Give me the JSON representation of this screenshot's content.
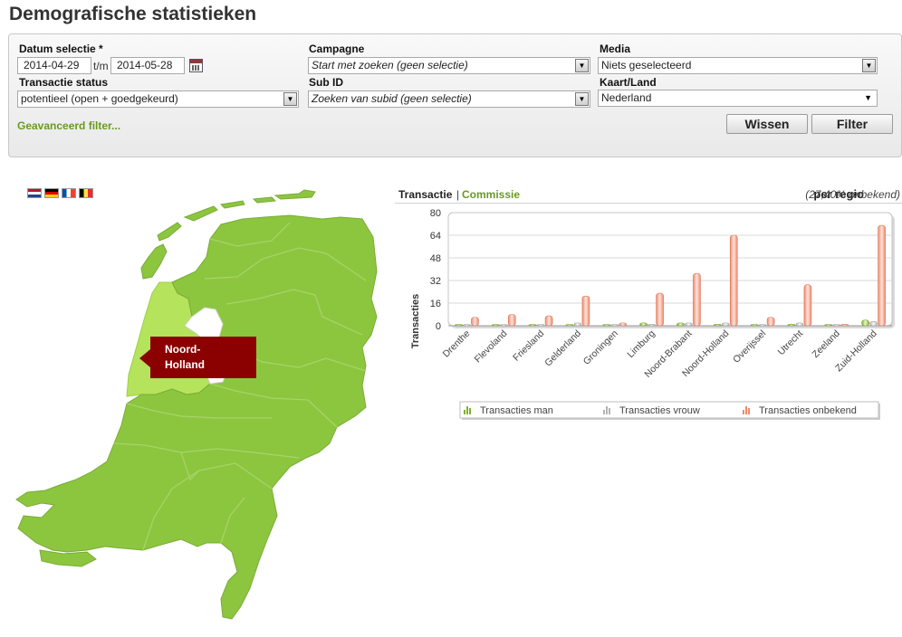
{
  "page": {
    "title": "Demografische statistieken"
  },
  "filters": {
    "datum_label": "Datum selectie *",
    "date_from": "2014-04-29",
    "tm_label": "t/m",
    "date_to": "2014-05-28",
    "campagne_label": "Campagne",
    "campagne_value": "Start met zoeken (geen selectie)",
    "media_label": "Media",
    "media_value": "Niets geselecteerd",
    "status_label": "Transactie status",
    "status_value": "potentieel (open + goedgekeurd)",
    "subid_label": "Sub ID",
    "subid_value": "Zoeken van subid (geen selectie)",
    "kaart_label": "Kaart/Land",
    "kaart_value": "Nederland",
    "advanced_link": "Geavanceerd filter...",
    "clear_button": "Wissen",
    "filter_button": "Filter"
  },
  "map": {
    "highlighted_region": "Noord-Holland",
    "tooltip_line1": "Noord-",
    "tooltip_line2": "Holland",
    "colors": {
      "region": "#8cc63f",
      "highlight": "#b5e35c",
      "tooltip": "#8b0000"
    }
  },
  "chart_header": {
    "tab_transactie": "Transactie",
    "separator": "|",
    "tab_commissie": "Commissie",
    "per_regio": "per regio",
    "onbekend": "(27,40% onbekend)"
  },
  "chart_data": {
    "type": "bar",
    "categories": [
      "Drenthe",
      "Flevoland",
      "Friesland",
      "Gelderland",
      "Groningen",
      "Limburg",
      "Noord-Brabant",
      "Noord-Holland",
      "Overijssel",
      "Utrecht",
      "Zeeland",
      "Zuid-Holland"
    ],
    "series": [
      {
        "name": "Transacties man",
        "color": "#8cc63f",
        "values": [
          0,
          0,
          0,
          0,
          0,
          2,
          2,
          1,
          0,
          1,
          0,
          4
        ]
      },
      {
        "name": "Transacties vrouw",
        "color": "#cccccc",
        "values": [
          0,
          0,
          0,
          2,
          0,
          1,
          2,
          2,
          0,
          2,
          0,
          3
        ]
      },
      {
        "name": "Transacties onbekend",
        "color": "#f4937a",
        "values": [
          6,
          8,
          7,
          21,
          2,
          23,
          37,
          64,
          6,
          29,
          1,
          71
        ]
      }
    ],
    "yticks": [
      "80",
      "64",
      "48",
      "32",
      "16",
      "0"
    ],
    "ylim": [
      0,
      80
    ],
    "ylabel": "Transacties",
    "grid": true,
    "legend": "bottom"
  }
}
